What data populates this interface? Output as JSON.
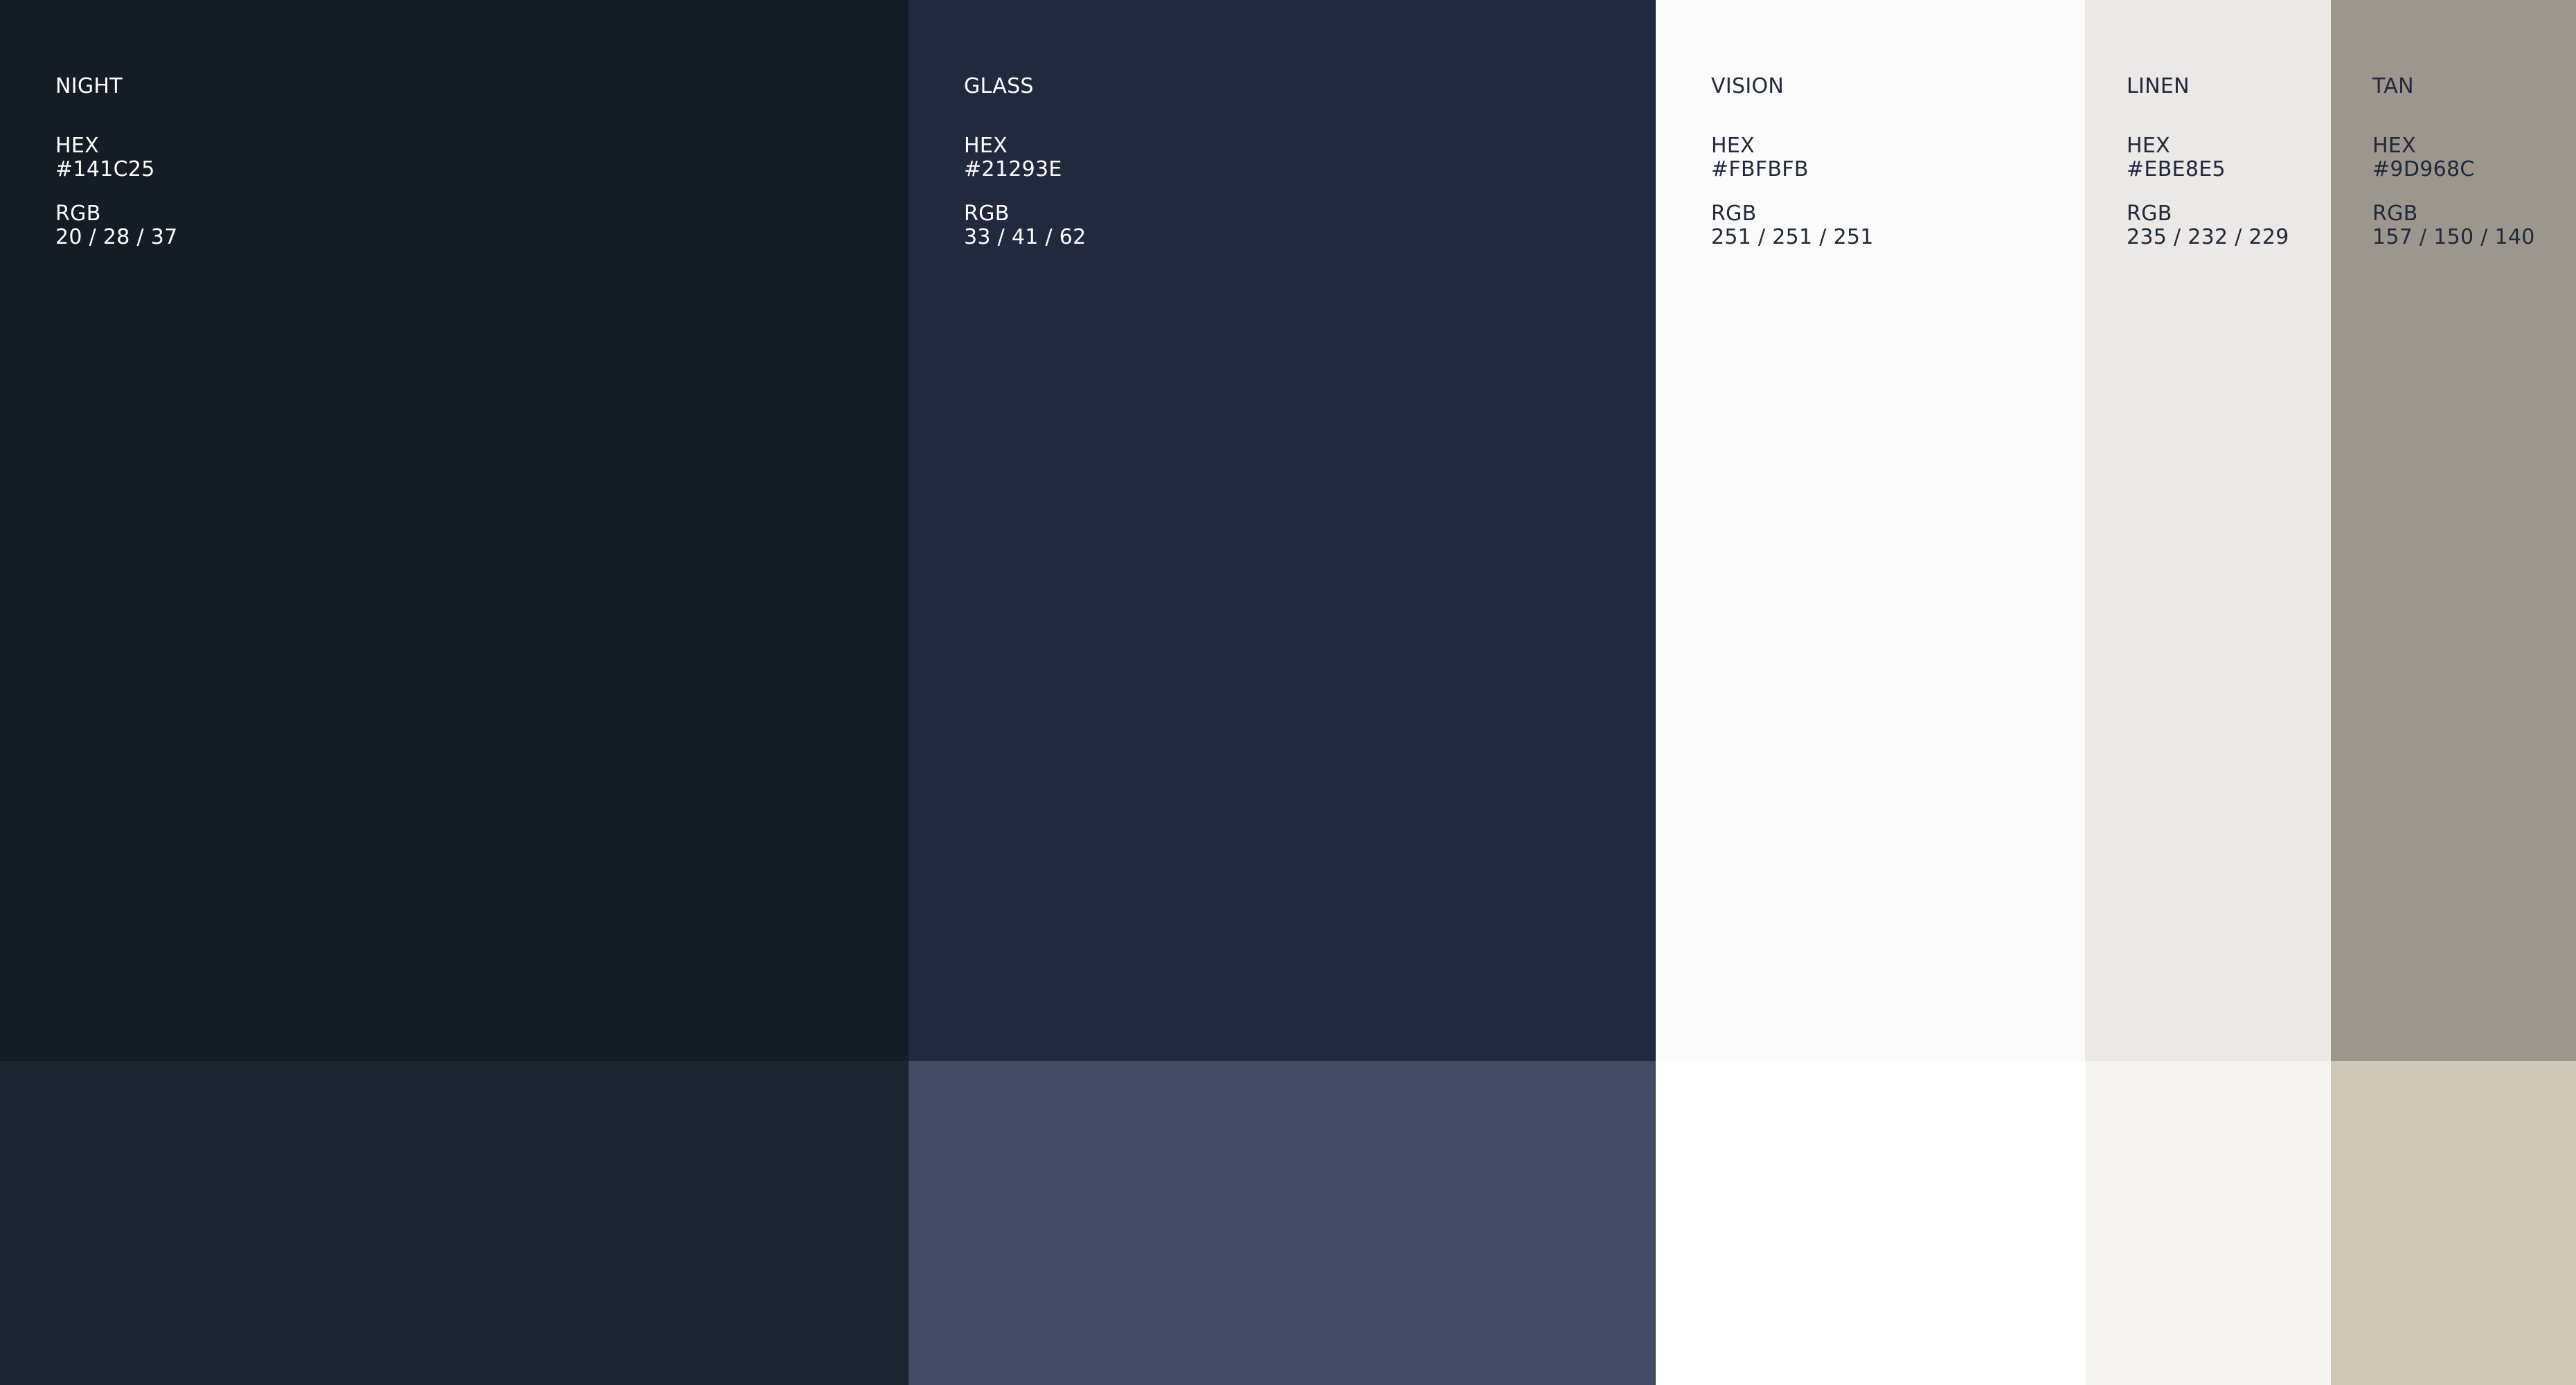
{
  "colors": [
    {
      "name": "NIGHT",
      "hex_label": "HEX",
      "hex": "#141C25",
      "rgb_label": "RGB",
      "rgb": "20 / 28 / 37",
      "primary_color": "#141C25",
      "secondary_color": "#1C2731"
    },
    {
      "name": "GLASS",
      "hex_label": "HEX",
      "hex": "#21293E",
      "rgb_label": "RGB",
      "rgb": "33 / 41 / 62",
      "primary_color": "#21293E",
      "secondary_color": "#434C62"
    },
    {
      "name": "VISION",
      "hex_label": "HEX",
      "hex": "#FBFBFB",
      "rgb_label": "RGB",
      "rgb": "251 / 251 / 251",
      "primary_color": "#FBFBFB",
      "secondary_color": "#FFFFFF"
    },
    {
      "name": "LINEN",
      "hex_label": "HEX",
      "hex": "#EBE8E5",
      "rgb_label": "RGB",
      "rgb": "235 / 232 / 229",
      "primary_color": "#EBE8E5",
      "secondary_color": "#F5F4F1"
    },
    {
      "name": "TAN",
      "hex_label": "HEX",
      "hex": "#9D968C",
      "rgb_label": "RGB",
      "rgb": "157 / 150 / 140",
      "primary_color": "#9D968C",
      "secondary_color": "#CFC6B8"
    }
  ]
}
